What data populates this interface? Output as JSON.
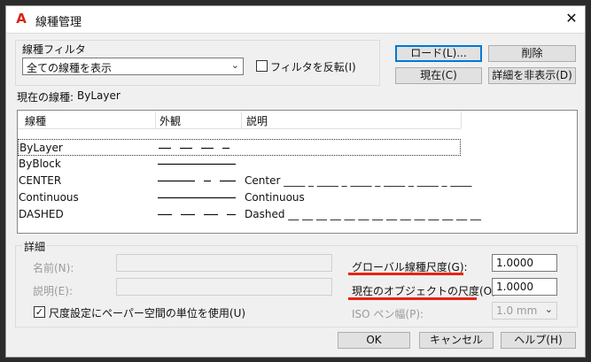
{
  "window": {
    "title": "線種管理",
    "close_glyph": "✕"
  },
  "filter": {
    "group_label": "線種フィルタ",
    "selected": "全ての線種を表示",
    "invert_label": "フィルタを反転(I)"
  },
  "buttons": {
    "load": "ロード(L)...",
    "delete": "削除",
    "current": "現在(C)",
    "hide_details": "詳細を非表示(D)",
    "ok": "OK",
    "cancel": "キャンセル",
    "help": "ヘルプ(H)"
  },
  "current_linetype": {
    "label": "現在の線種:",
    "value": "ByLayer"
  },
  "table": {
    "columns": [
      "線種",
      "外観",
      "説明"
    ],
    "rows": [
      {
        "name": "ByLayer",
        "description": ""
      },
      {
        "name": "ByBlock",
        "description": ""
      },
      {
        "name": "CENTER",
        "description": "Center ____ _ ____ _ ____ _ ____ _ ____ _ ____"
      },
      {
        "name": "Continuous",
        "description": "Continuous"
      },
      {
        "name": "DASHED",
        "description": "Dashed __ __ __ __ __ __ __ __ __ __ __ __ __ __"
      }
    ]
  },
  "details": {
    "group_label": "詳細",
    "name_label": "名前(N):",
    "description_label": "説明(E):",
    "paper_space_label": "尺度設定にペーパー空間の単位を使用(U)",
    "paper_space_checked": true,
    "global_scale_label": "グローバル線種尺度(G):",
    "global_scale_value": "1.0000",
    "object_scale_label": "現在のオブジェクトの尺度(O):",
    "object_scale_value": "1.0000",
    "iso_pen_label": "ISO ペン幅(P):",
    "iso_pen_value": "1.0 mm"
  },
  "colors": {
    "accent": "#0078d7",
    "annotation": "#e8230f",
    "logo": "#d9230f"
  }
}
